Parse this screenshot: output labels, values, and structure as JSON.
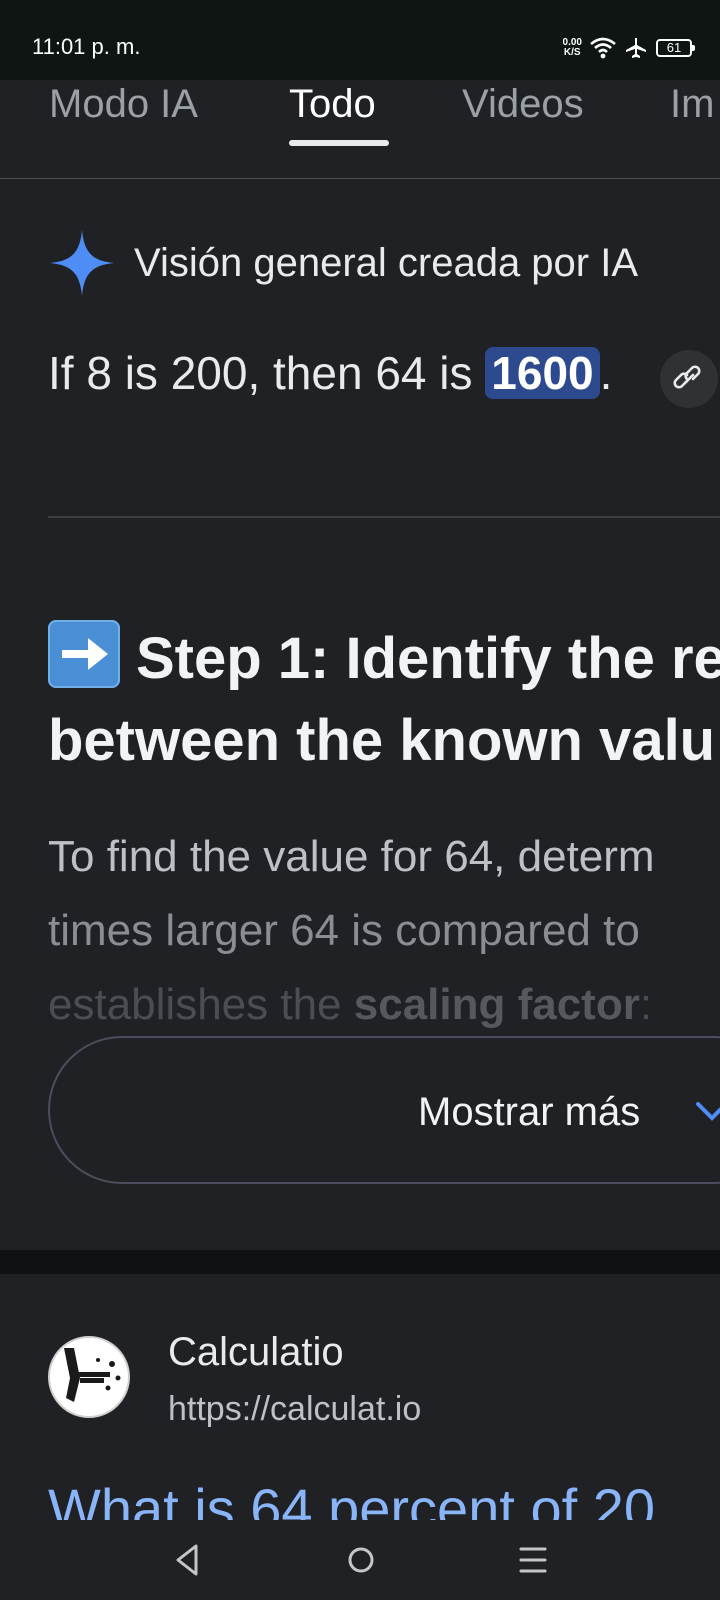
{
  "status_bar": {
    "time": "11:01 p. m.",
    "net_speed_value": "0.00",
    "net_speed_unit": "K/S",
    "battery_level": "61",
    "icons": [
      "wifi-icon",
      "airplane-mode-icon",
      "battery-icon"
    ]
  },
  "tabs": {
    "items": [
      {
        "label": "Modo IA",
        "active": false
      },
      {
        "label": "Todo",
        "active": true
      },
      {
        "label": "Videos",
        "active": false
      },
      {
        "label": "Im",
        "active": false
      }
    ]
  },
  "ai_overview": {
    "header_label": "Visión general creada por IA",
    "answer_prefix": "If 8 is 200, then 64 is ",
    "answer_highlight": "1600",
    "answer_suffix": ".",
    "step_heading_line1": "Step 1: Identify the re",
    "step_heading_line2": "between the known valu",
    "body_line1": "To find the value for 64, determ",
    "body_line2": "times larger 64 is compared to",
    "body_line3_prefix": "establishes the ",
    "body_line3_bold": "scaling factor",
    "body_line3_suffix": ":",
    "show_more_label": "Mostrar más"
  },
  "search_result": {
    "site_name": "Calculatio",
    "url": "https://calculat.io",
    "title": "What is 64 percent of 20"
  },
  "colors": {
    "background": "#202124",
    "link_blue": "#8ab4f8",
    "gemini_blue": "#4e8df5",
    "highlight": "#2d4a8f"
  }
}
